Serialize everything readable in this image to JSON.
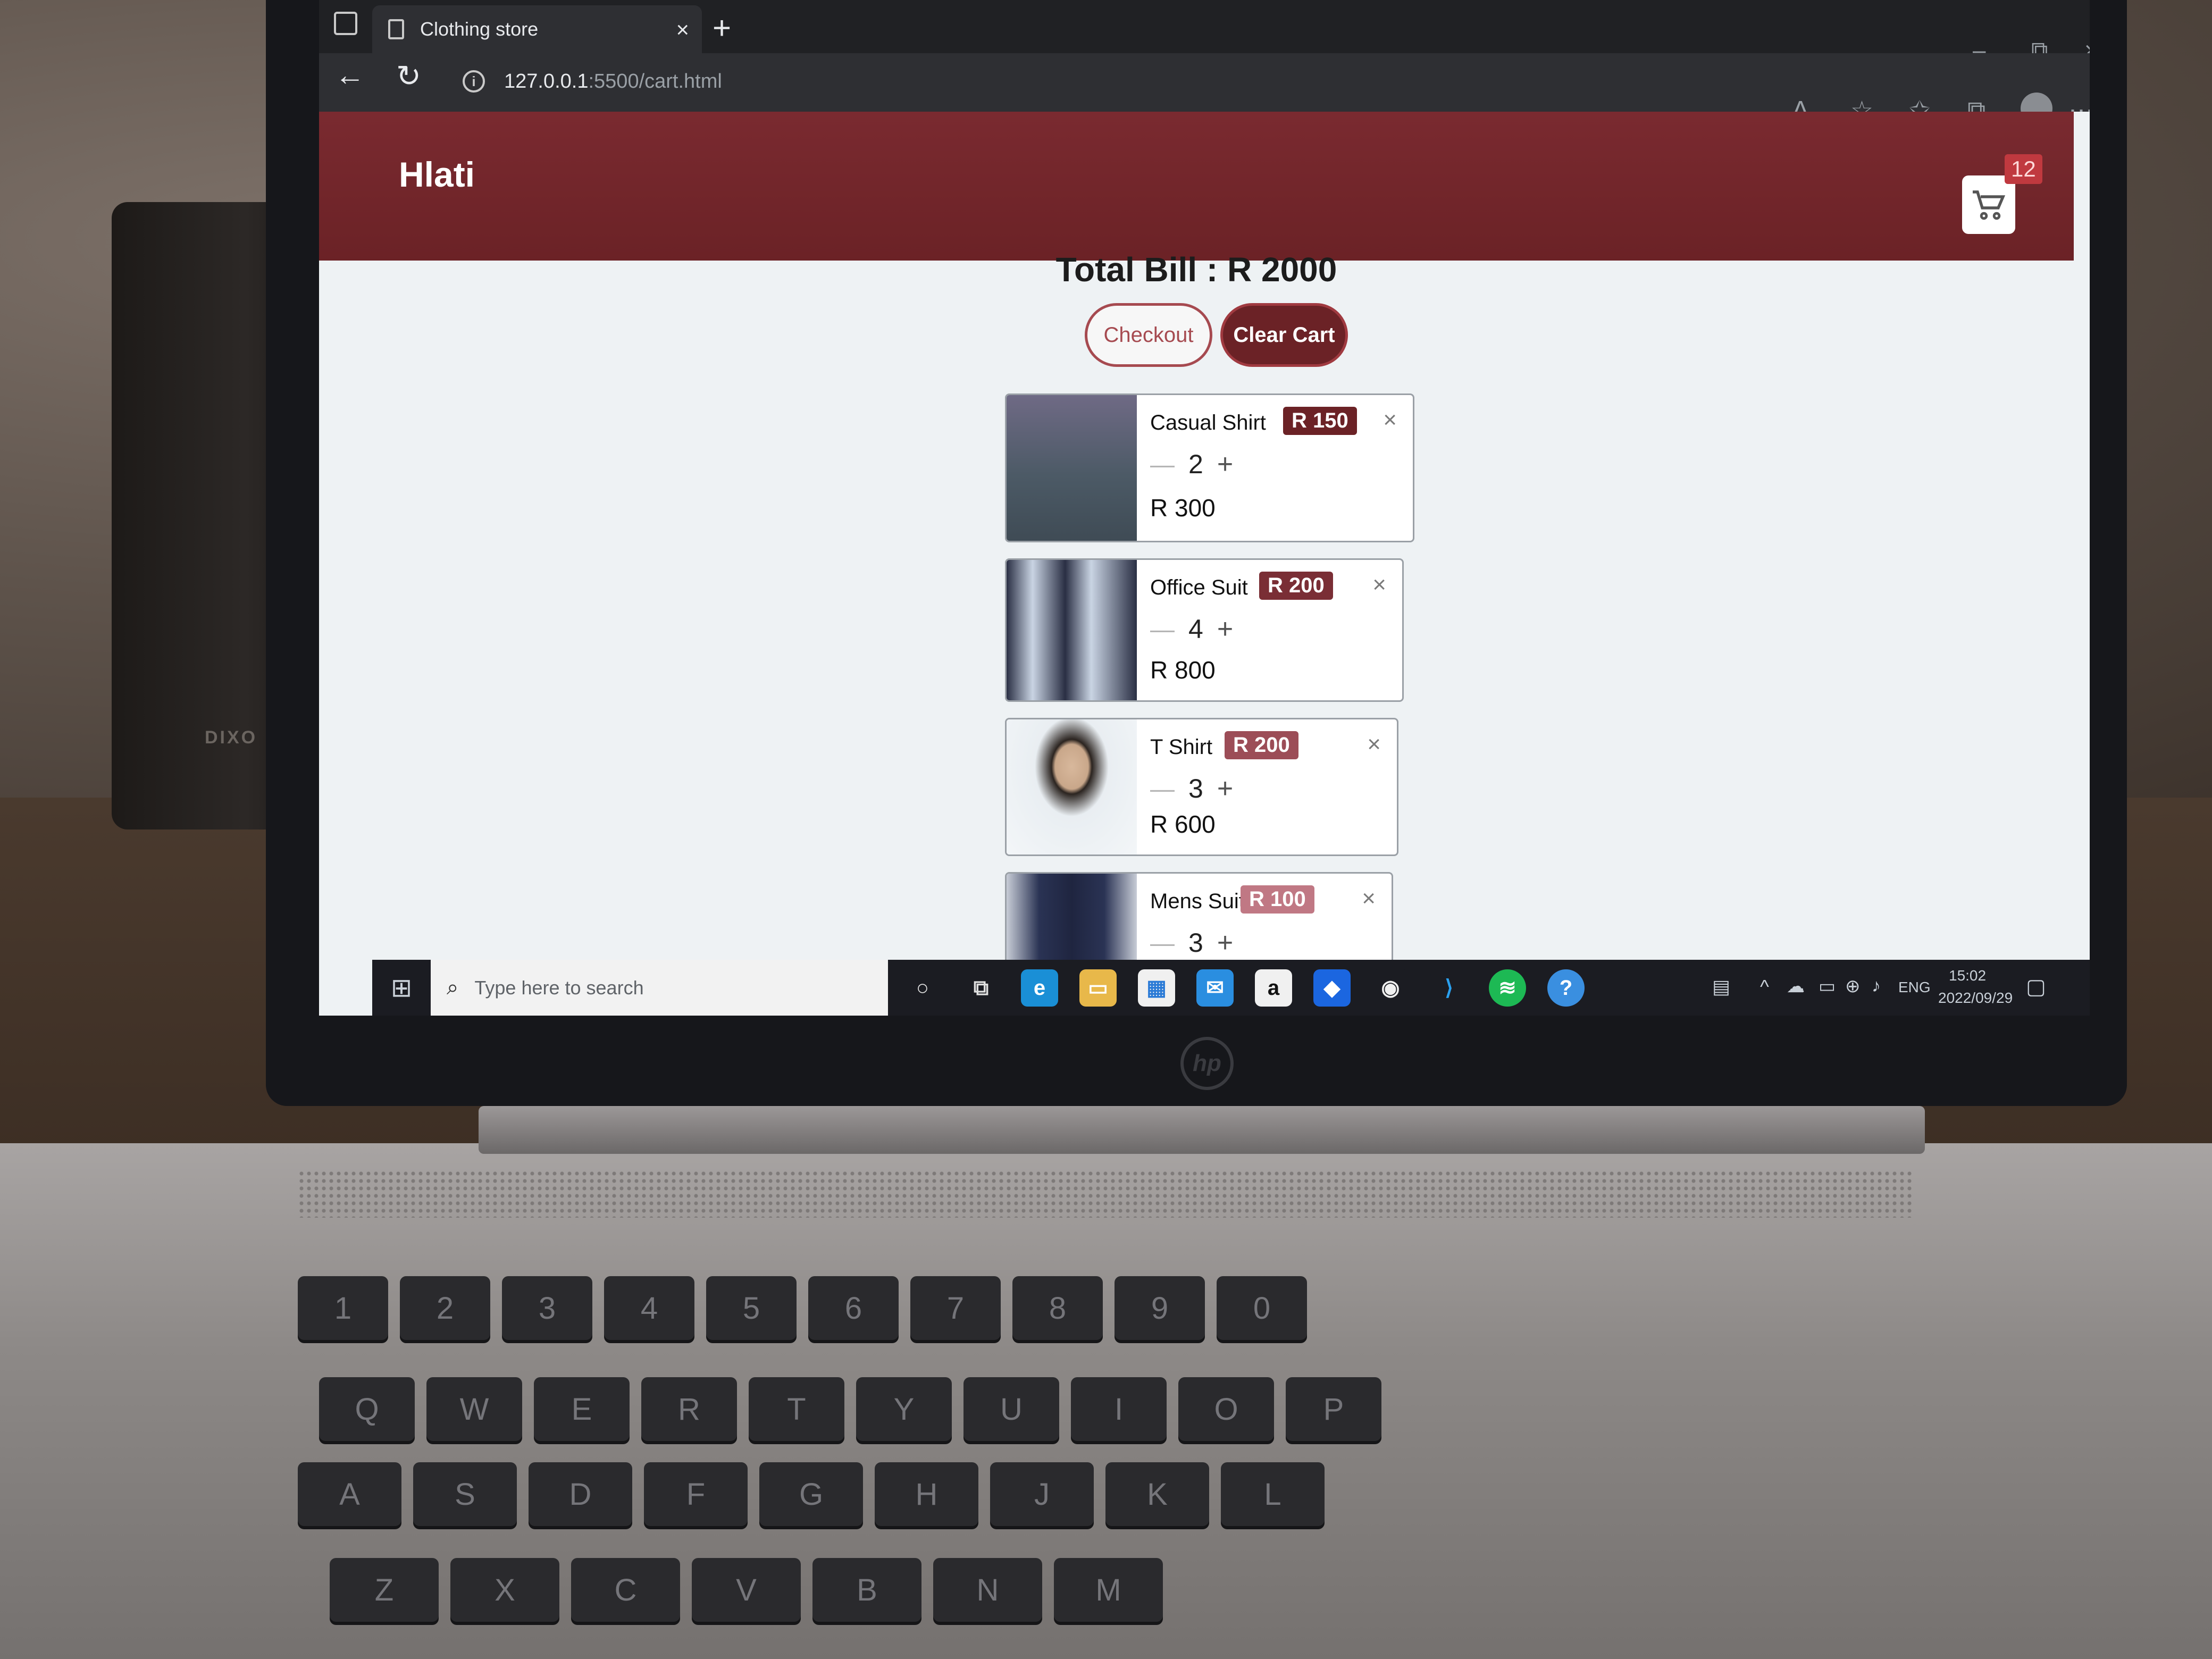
{
  "browser": {
    "tab_title": "Clothing store",
    "url_host": "127.0.0.1",
    "url_path": ":5500/cart.html"
  },
  "site": {
    "brand": "Hlati",
    "cart_count": "12",
    "colors": {
      "header": "#6b2226",
      "accent": "#a03a40"
    }
  },
  "cart": {
    "total_label": "Total Bill : R 2000",
    "checkout_label": "Checkout",
    "clear_label": "Clear Cart",
    "items": [
      {
        "name": "Casual Shirt",
        "price": "R 150",
        "qty": "2",
        "subtotal": "R 300",
        "badge_color": "#6b2226"
      },
      {
        "name": "Office Suit",
        "price": "R 200",
        "qty": "4",
        "subtotal": "R 800",
        "badge_color": "#7a2e35"
      },
      {
        "name": "T Shirt",
        "price": "R 200",
        "qty": "3",
        "subtotal": "R 600",
        "badge_color": "#9c4d57"
      },
      {
        "name": "Mens Suit",
        "price": "R 100",
        "qty": "3",
        "subtotal": "",
        "badge_color": "#c07884"
      }
    ]
  },
  "taskbar": {
    "search_placeholder": "Type here to search",
    "language": "ENG",
    "time": "15:02",
    "date": "2022/09/29"
  },
  "laptop": {
    "speaker_label": "DIXO",
    "keys_row1": [
      "Q",
      "W",
      "E",
      "R",
      "T",
      "Y",
      "U",
      "I",
      "O",
      "P"
    ],
    "keys_row2": [
      "A",
      "S",
      "D",
      "F",
      "G",
      "H",
      "J",
      "K",
      "L"
    ],
    "keys_row3": [
      "Z",
      "X",
      "C",
      "V",
      "B",
      "N",
      "M"
    ],
    "keys_row0": [
      "1",
      "2",
      "3",
      "4",
      "5",
      "6",
      "7",
      "8",
      "9",
      "0"
    ]
  }
}
